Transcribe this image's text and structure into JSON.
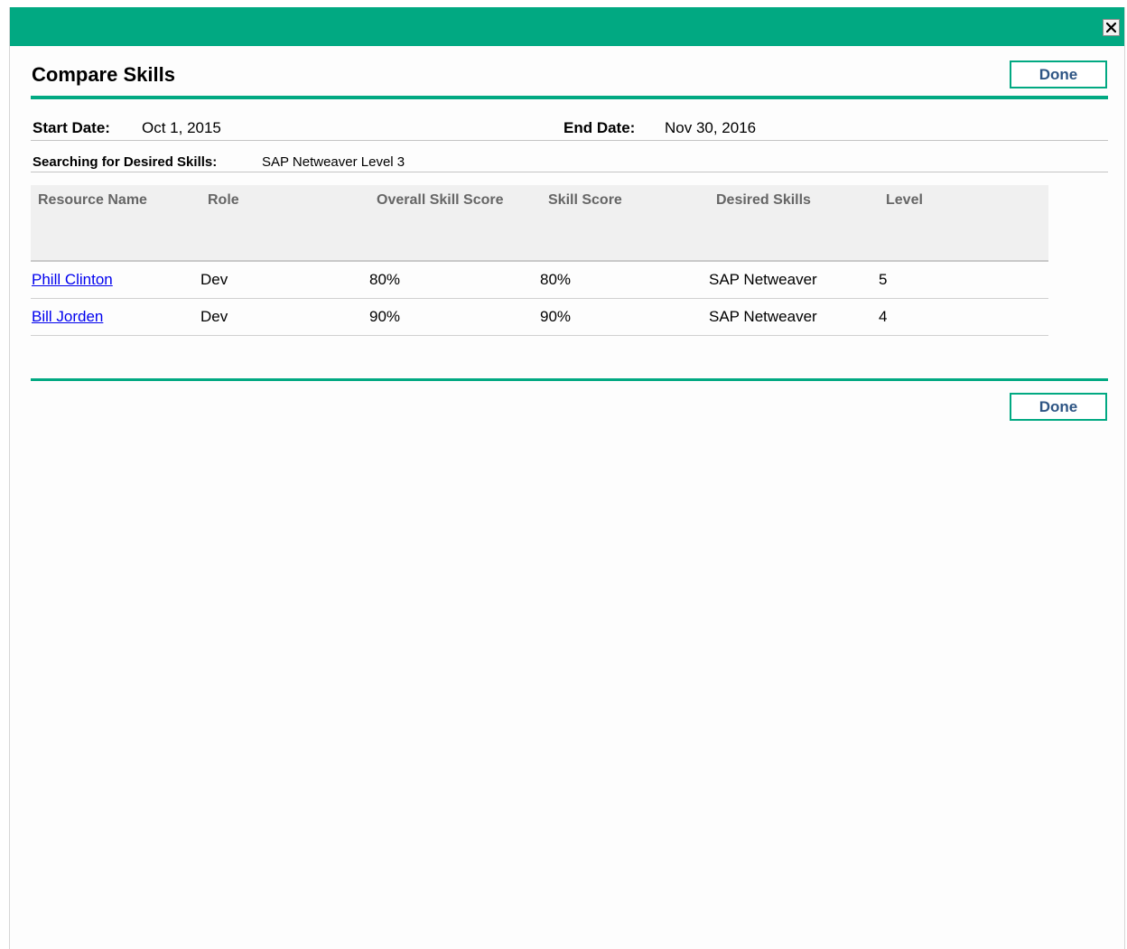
{
  "dialog": {
    "title": "Compare Skills",
    "done_label": "Done",
    "close_icon": "close-icon"
  },
  "dates": {
    "start_label": "Start Date:",
    "start_value": "Oct 1, 2015",
    "end_label": "End Date:",
    "end_value": "Nov 30, 2016"
  },
  "search": {
    "label": "Searching for Desired Skills:",
    "value": "SAP Netweaver Level 3"
  },
  "table": {
    "columns": [
      "Resource Name",
      "Role",
      "Overall Skill Score",
      "Skill Score",
      "Desired Skills",
      "Level"
    ],
    "rows": [
      [
        "Phill Clinton",
        "Dev",
        "80%",
        "80%",
        "SAP Netweaver",
        "5"
      ],
      [
        "Bill Jorden",
        "Dev",
        "90%",
        "90%",
        "SAP Netweaver",
        "4"
      ]
    ]
  },
  "colors": {
    "accent": "#01a982",
    "link": "#0000ee",
    "button_text": "#2e5584"
  }
}
